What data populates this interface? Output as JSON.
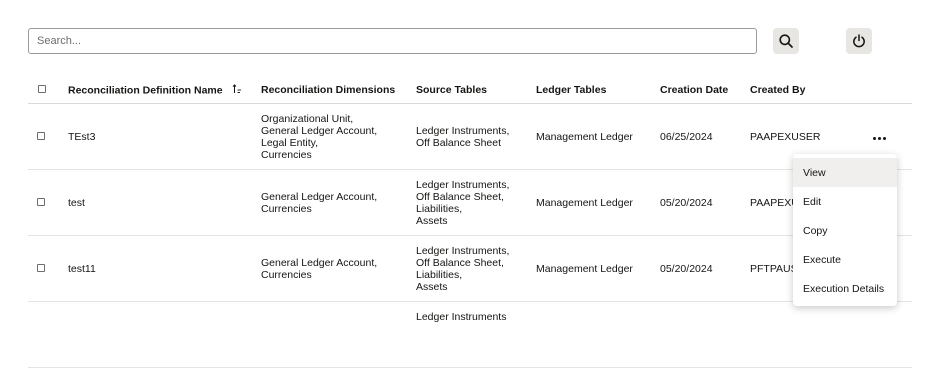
{
  "search": {
    "placeholder": "Search..."
  },
  "table": {
    "headers": {
      "name": "Reconciliation Definition Name",
      "dimensions": "Reconciliation Dimensions",
      "source": "Source Tables",
      "ledger": "Ledger Tables",
      "date": "Creation Date",
      "created_by": "Created By"
    },
    "rows": [
      {
        "name": "TEst3",
        "dimensions": [
          "Organizational Unit,",
          "General Ledger Account,",
          "Legal Entity,",
          "Currencies"
        ],
        "source": [
          "Ledger Instruments,",
          "Off Balance Sheet"
        ],
        "ledger": "Management Ledger",
        "date": "06/25/2024",
        "created_by": "PAAPEXUSER"
      },
      {
        "name": "test",
        "dimensions": [
          "General Ledger Account,",
          "Currencies"
        ],
        "source": [
          "Ledger Instruments,",
          "Off Balance Sheet,",
          "Liabilities,",
          "Assets"
        ],
        "ledger": "Management Ledger",
        "date": "05/20/2024",
        "created_by": "PAAPEXU"
      },
      {
        "name": "test11",
        "dimensions": [
          "General Ledger Account,",
          "Currencies"
        ],
        "source": [
          "Ledger Instruments,",
          "Off Balance Sheet,",
          "Liabilities,",
          "Assets"
        ],
        "ledger": "Management Ledger",
        "date": "05/20/2024",
        "created_by": "PFTPAUS"
      },
      {
        "source": [
          "Ledger Instruments"
        ]
      }
    ]
  },
  "menu": {
    "items": [
      "View",
      "Edit",
      "Copy",
      "Execute",
      "Execution Details"
    ]
  },
  "icons": {
    "search": "search-icon",
    "refresh": "power-refresh-icon",
    "sort": "sort-icon",
    "more": "ellipsis-icon"
  }
}
